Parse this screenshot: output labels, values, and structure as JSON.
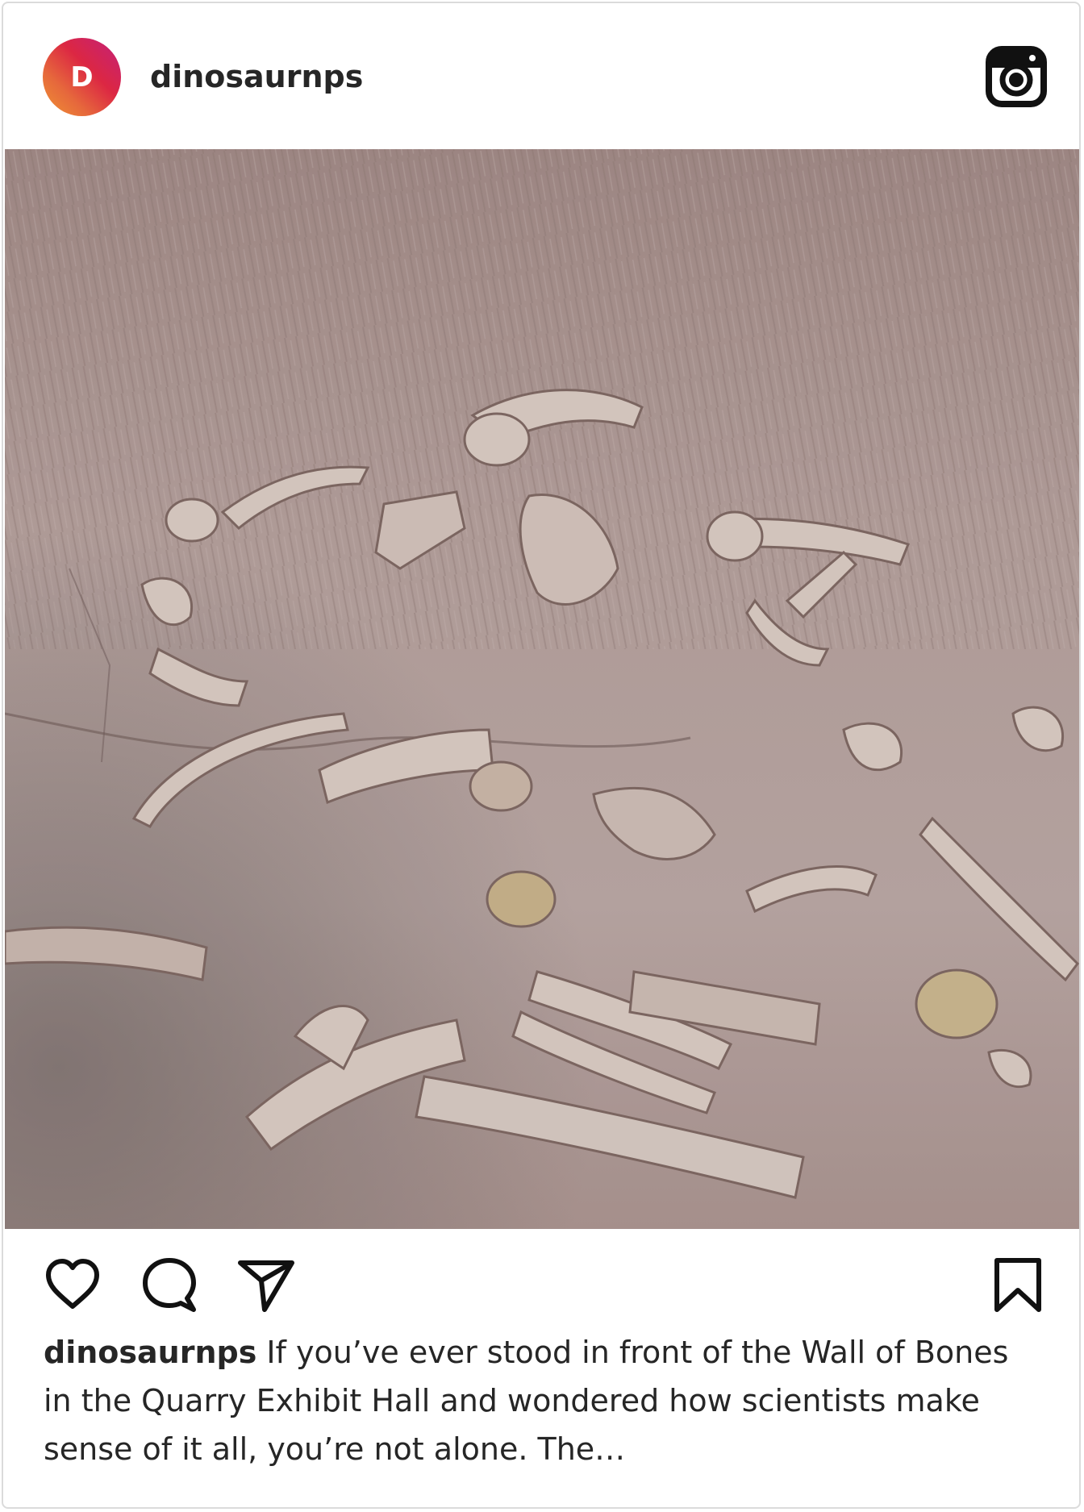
{
  "post": {
    "avatar_initial": "D",
    "username": "dinosaurnps",
    "caption_user": "dinosaurnps",
    "caption_text": "If you’ve ever stood in front of the Wall of Bones in the Quarry Exhibit Hall and wondered how scientists make sense of it all, you’re not alone. The…"
  },
  "icons": {
    "logo": "instagram-icon",
    "like": "heart-icon",
    "comment": "comment-icon",
    "share": "paper-plane-icon",
    "save": "bookmark-icon"
  },
  "colors": {
    "text": "#262626",
    "border": "#dbdbdb",
    "avatar_gradient_start": "#f09433",
    "avatar_gradient_end": "#bc1888"
  }
}
